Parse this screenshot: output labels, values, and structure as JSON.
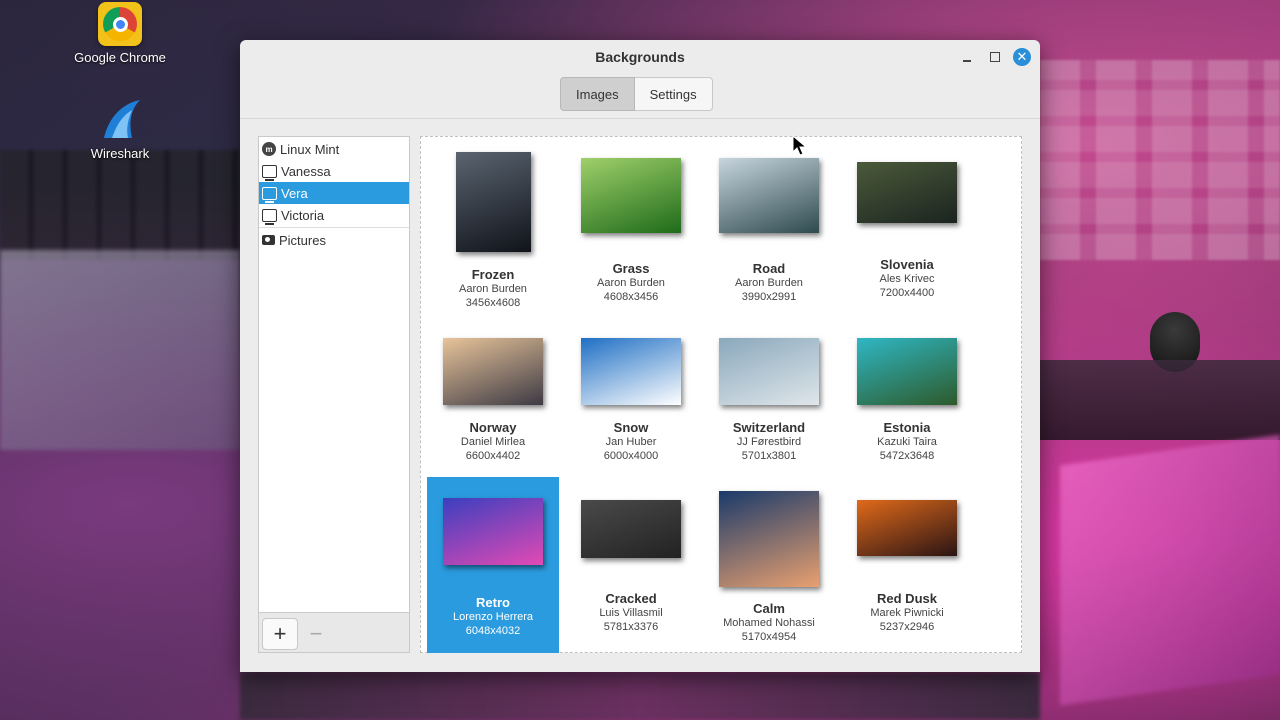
{
  "desktop": {
    "icons": [
      {
        "label": "Google Chrome",
        "icon": "chrome-icon"
      },
      {
        "label": "Wireshark",
        "icon": "wireshark-icon"
      }
    ]
  },
  "window": {
    "title": "Backgrounds",
    "controls": {
      "minimize": "minimize",
      "maximize": "maximize",
      "close": "✕"
    }
  },
  "tabs": [
    {
      "label": "Images",
      "active": true
    },
    {
      "label": "Settings",
      "active": false
    }
  ],
  "sidebar": {
    "items": [
      {
        "label": "Linux Mint",
        "icon": "linux-mint-icon"
      },
      {
        "label": "Vanessa",
        "icon": "monitor-icon"
      },
      {
        "label": "Vera",
        "icon": "monitor-icon",
        "selected": true
      },
      {
        "label": "Victoria",
        "icon": "monitor-icon"
      },
      {
        "label": "Pictures",
        "icon": "camera-icon"
      }
    ],
    "add_label": "+",
    "remove_label": "−"
  },
  "backgrounds": [
    {
      "name": "Frozen",
      "author": "Aaron Burden",
      "dims": "3456x4608",
      "colors": [
        "#5a6470",
        "#10131a"
      ]
    },
    {
      "name": "Grass",
      "author": "Aaron Burden",
      "dims": "4608x3456",
      "colors": [
        "#9fd06a",
        "#1f6b1a"
      ]
    },
    {
      "name": "Road",
      "author": "Aaron Burden",
      "dims": "3990x2991",
      "colors": [
        "#c7d5de",
        "#2e4a4f"
      ]
    },
    {
      "name": "Slovenia",
      "author": "Ales Krivec",
      "dims": "7200x4400",
      "colors": [
        "#4b5a3a",
        "#1b2420"
      ]
    },
    {
      "name": "Norway",
      "author": "Daniel Mirlea",
      "dims": "6600x4402",
      "colors": [
        "#e8c49a",
        "#3d3a44"
      ]
    },
    {
      "name": "Snow",
      "author": "Jan Huber",
      "dims": "6000x4000",
      "colors": [
        "#1f6fc4",
        "#ffffff"
      ]
    },
    {
      "name": "Switzerland",
      "author": "JJ Førestbird",
      "dims": "5701x3801",
      "colors": [
        "#8aa8bc",
        "#dfe6ea"
      ]
    },
    {
      "name": "Estonia",
      "author": "Kazuki Taira",
      "dims": "5472x3648",
      "colors": [
        "#2fb7c4",
        "#2d5a2a"
      ]
    },
    {
      "name": "Retro",
      "author": "Lorenzo Herrera",
      "dims": "6048x4032",
      "colors": [
        "#3b3fbf",
        "#e24ab4"
      ],
      "selected": true
    },
    {
      "name": "Cracked",
      "author": "Luis Villasmil",
      "dims": "5781x3376",
      "colors": [
        "#4a4a4a",
        "#222222"
      ]
    },
    {
      "name": "Calm",
      "author": "Mohamed Nohassi",
      "dims": "5170x4954",
      "colors": [
        "#1a3a6a",
        "#e8a070"
      ]
    },
    {
      "name": "Red Dusk",
      "author": "Marek Piwnicki",
      "dims": "5237x2946",
      "colors": [
        "#e06a1a",
        "#2a1414"
      ]
    }
  ]
}
